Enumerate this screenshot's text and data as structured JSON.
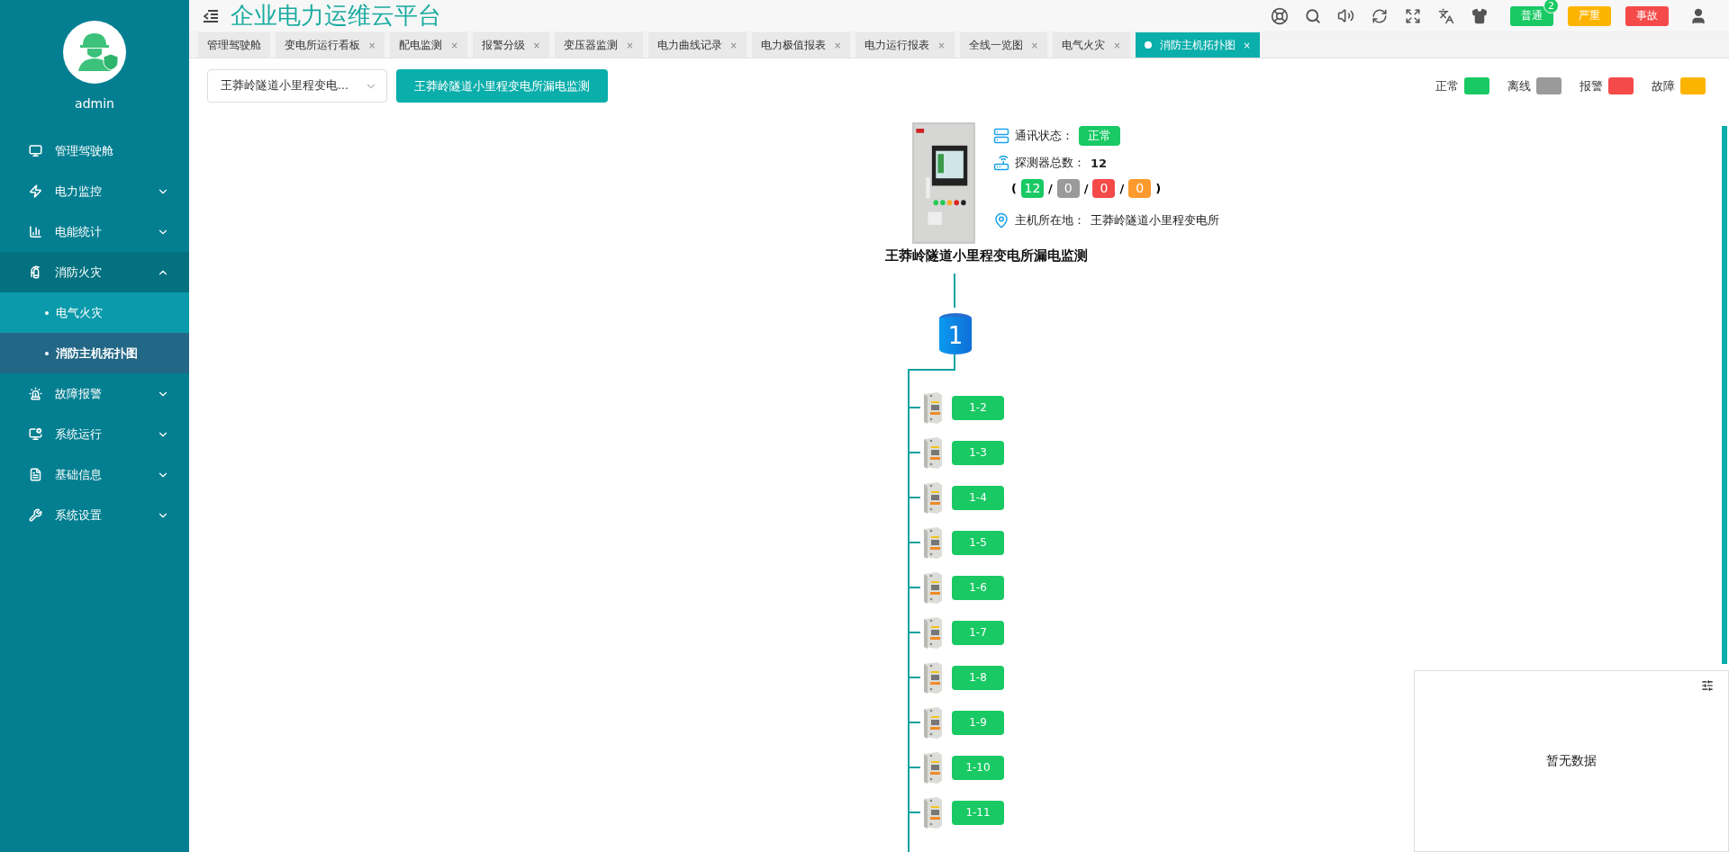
{
  "sidebar": {
    "user": "admin",
    "menu": [
      {
        "label": "管理驾驶舱",
        "kind": "link"
      },
      {
        "label": "电力监控",
        "kind": "group",
        "expanded": false
      },
      {
        "label": "电能统计",
        "kind": "group",
        "expanded": false
      },
      {
        "label": "消防火灾",
        "kind": "group",
        "expanded": true,
        "children": [
          {
            "label": "电气火灾",
            "selected": false,
            "highlighted": true
          },
          {
            "label": "消防主机拓扑图",
            "selected": true,
            "highlighted": false
          }
        ]
      },
      {
        "label": "故障报警",
        "kind": "group",
        "expanded": false
      },
      {
        "label": "系统运行",
        "kind": "group",
        "expanded": false
      },
      {
        "label": "基础信息",
        "kind": "group",
        "expanded": false
      },
      {
        "label": "系统设置",
        "kind": "group",
        "expanded": false
      }
    ]
  },
  "header": {
    "title": "企业电力运维云平台",
    "alerts": [
      {
        "label": "普通",
        "color": "#19c964",
        "count": "2"
      },
      {
        "label": "严重",
        "color": "#fdb400"
      },
      {
        "label": "事故",
        "color": "#f54a4a"
      }
    ]
  },
  "tabs": [
    {
      "label": "管理驾驶舱",
      "selected": false
    },
    {
      "label": "变电所运行看板",
      "close": "×",
      "selected": false
    },
    {
      "label": "配电监测",
      "close": "×",
      "selected": false
    },
    {
      "label": "报警分级",
      "close": "×",
      "selected": false
    },
    {
      "label": "变压器监测",
      "close": "×",
      "selected": false
    },
    {
      "label": "电力曲线记录",
      "close": "×",
      "selected": false
    },
    {
      "label": "电力极值报表",
      "close": "×",
      "selected": false
    },
    {
      "label": "电力运行报表",
      "close": "×",
      "selected": false
    },
    {
      "label": "全线一览图",
      "close": "×",
      "selected": false
    },
    {
      "label": "电气火灾",
      "close": "×",
      "selected": false
    },
    {
      "label": "消防主机拓扑图",
      "close": "×",
      "selected": true
    }
  ],
  "filter": {
    "select_value": "王莽岭隧道小里程变电...",
    "button": "王莽岭隧道小里程变电所漏电监测"
  },
  "legend": [
    {
      "label": "正常",
      "color": "#19c964"
    },
    {
      "label": "离线",
      "color": "#9a9a9a"
    },
    {
      "label": "报警",
      "color": "#f54a4a"
    },
    {
      "label": "故障",
      "color": "#fdb400"
    }
  ],
  "host": {
    "comm_label": "通讯状态：",
    "comm_status": "正常",
    "detector_label": "探测器总数：",
    "detector_total": "12",
    "open_paren": "(",
    "separator": "/",
    "close_paren": ")",
    "counts": [
      {
        "value": "12",
        "color": "#19c964"
      },
      {
        "value": "0",
        "color": "#9a9a9a"
      },
      {
        "value": "0",
        "color": "#f54a4a"
      },
      {
        "value": "0",
        "color": "#fd9a2e"
      }
    ],
    "location_label": "主机所在地：",
    "location": "王莽岭隧道小里程变电所",
    "title": "王莽岭隧道小里程变电所漏电监测",
    "bus": "1"
  },
  "detectors": [
    {
      "label": "1-2",
      "color": "#19c964"
    },
    {
      "label": "1-3",
      "color": "#19c964"
    },
    {
      "label": "1-4",
      "color": "#19c964"
    },
    {
      "label": "1-5",
      "color": "#19c964"
    },
    {
      "label": "1-6",
      "color": "#19c964"
    },
    {
      "label": "1-7",
      "color": "#19c964"
    },
    {
      "label": "1-8",
      "color": "#19c964"
    },
    {
      "label": "1-9",
      "color": "#19c964"
    },
    {
      "label": "1-10",
      "color": "#19c964"
    },
    {
      "label": "1-11",
      "color": "#19c964"
    }
  ],
  "panel": {
    "empty_text": "暂无数据"
  }
}
